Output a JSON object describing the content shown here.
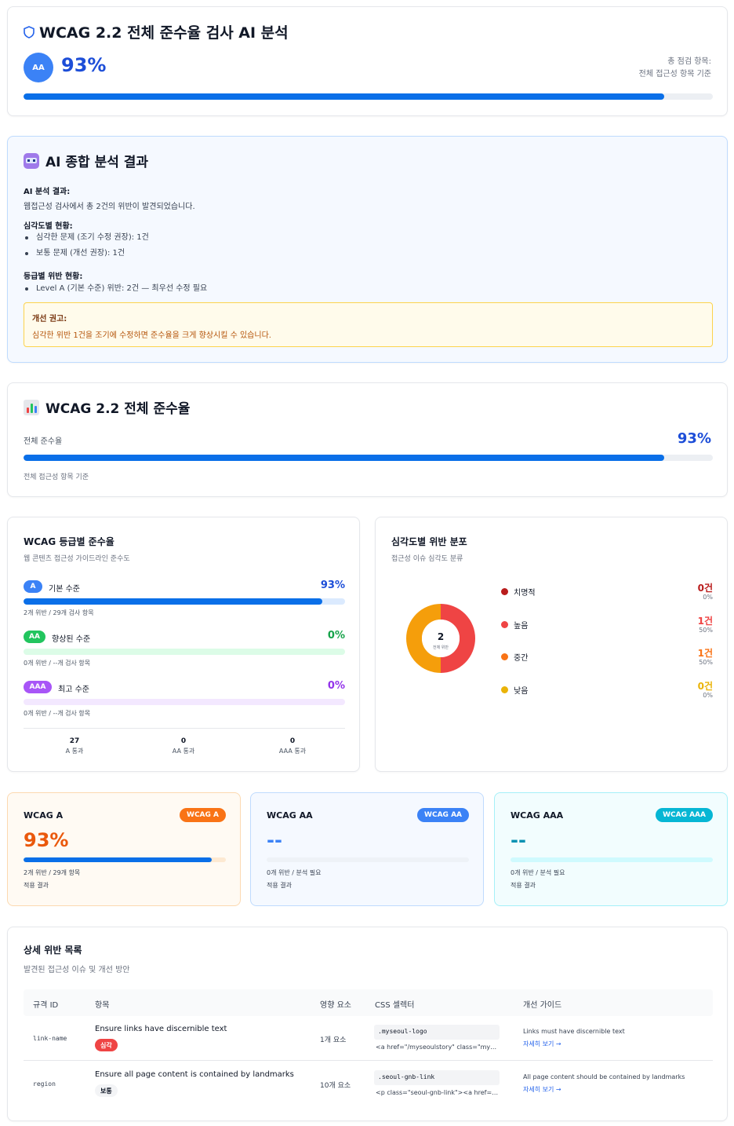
{
  "header": {
    "title": "WCAG 2.2 전체 준수율 검사 AI 분석",
    "level_badge": "AA",
    "score": "93%",
    "score_value": 0.93,
    "meta_line1": "총 점검 항목:",
    "meta_line2": "전체 접근성 항목 기준"
  },
  "ai_analysis": {
    "title": "AI 종합 분석 결과",
    "result_heading": "AI 분석 결과:",
    "result_text": "웹접근성 검사에서 총 2건의 위반이 발견되었습니다.",
    "severity_heading": "심각도별 현황:",
    "severity_items": [
      "심각한 문제 (조기 수정 권장): 1건",
      "보통 문제 (개선 권장): 1건"
    ],
    "level_heading": "등급별 위반 현황:",
    "level_items": [
      "Level A (기본 수준) 위반: 2건 — 최우선 수정 필요"
    ],
    "advice_heading": "개선 권고:",
    "advice_text": "심각한 위반 1건을 조기에 수정하면 준수율을 크게 향상시킬 수 있습니다."
  },
  "overall": {
    "title": "WCAG 2.2 전체 준수율",
    "label": "전체 준수율",
    "score": "93%",
    "score_value": 0.93,
    "note": "전체 접근성 항목 기준"
  },
  "level_compliance": {
    "title": "WCAG 등급별 준수율",
    "subtitle": "웹 콘텐츠 접근성 가이드라인 준수도",
    "levels": [
      {
        "badge": "A",
        "name": "기본 수준",
        "value": "93%",
        "fill": 0.93,
        "stat": "2개 위반 / 29개 검사 항목",
        "color": "#3b82f6",
        "track": "#dbeafe",
        "fill_color": "#0a6fe8",
        "value_color": "#1d4ed8"
      },
      {
        "badge": "AA",
        "name": "향상된 수준",
        "value": "0%",
        "fill": 0,
        "stat": "0개 위반 / --개 검사 항목",
        "color": "#22c55e",
        "track": "#dcfce7",
        "fill_color": "#16a34a",
        "value_color": "#16a34a"
      },
      {
        "badge": "AAA",
        "name": "최고 수준",
        "value": "0%",
        "fill": 0,
        "stat": "0개 위반 / --개 검사 항목",
        "color": "#a855f7",
        "track": "#f3e8ff",
        "fill_color": "#9333ea",
        "value_color": "#9333ea"
      }
    ],
    "summary": [
      {
        "n": "27",
        "label": "A 통과"
      },
      {
        "n": "0",
        "label": "AA 통과"
      },
      {
        "n": "0",
        "label": "AAA 통과"
      }
    ]
  },
  "severity": {
    "title": "심각도별 위반 분포",
    "subtitle": "접근성 이슈 심각도 분류",
    "total": "2",
    "total_label": "전체 위반",
    "items": [
      {
        "name": "치명적",
        "count": "0건",
        "pct": "0%",
        "value": 0,
        "color": "#b91c1c"
      },
      {
        "name": "높음",
        "count": "1건",
        "pct": "50%",
        "value": 1,
        "color": "#ef4444"
      },
      {
        "name": "중간",
        "count": "1건",
        "pct": "50%",
        "value": 1,
        "color": "#f97316"
      },
      {
        "name": "낮음",
        "count": "0건",
        "pct": "0%",
        "value": 0,
        "color": "#eab308"
      }
    ],
    "chart_colors": [
      "#ef4444",
      "#f59e0b"
    ]
  },
  "level_cards": [
    {
      "title": "WCAG A",
      "pill": "WCAG A",
      "big": "93%",
      "fill": 0.93,
      "s1": "2개 위반 / 29개 항목",
      "s2": "적용 결과",
      "accent": "#f97316",
      "big_color": "#ea580c",
      "bg": "#fffaf3",
      "border": "#fcd9b0",
      "track": "#fde9d2"
    },
    {
      "title": "WCAG AA",
      "pill": "WCAG AA",
      "big": "--",
      "fill": 0,
      "s1": "0개 위반 / 분석 필요",
      "s2": "적용 결과",
      "accent": "#3b82f6",
      "big_color": "#3b82f6",
      "bg": "#f5f9ff",
      "border": "#bfdbfe",
      "track": "#eef2f7"
    },
    {
      "title": "WCAG AAA",
      "pill": "WCAG AAA",
      "big": "--",
      "fill": 0,
      "s1": "0개 위반 / 분석 필요",
      "s2": "적용 결과",
      "accent": "#06b6d4",
      "big_color": "#0891b2",
      "bg": "#f2fdfe",
      "border": "#a5f0f8",
      "track": "#cffafe"
    }
  ],
  "details": {
    "title": "상세 위반 목록",
    "subtitle": "발견된 접근성 이슈 및 개선 방안",
    "columns": [
      "규격 ID",
      "항목",
      "영향 요소",
      "CSS 셀렉터",
      "개선 가이드"
    ],
    "rows": [
      {
        "id": "link-name",
        "item": "Ensure links have discernible text",
        "badge": "심각",
        "badge_bg": "#ef4444",
        "badge_fg": "#ffffff",
        "impact": "1개 요소",
        "selector": ".myseoul-logo",
        "html": "<a href=\"/myseoulstory\" class=\"myseoul-logo\">",
        "guide": "Links must have discernible text",
        "link": "자세히 보기 →"
      },
      {
        "id": "region",
        "item": "Ensure all page content is contained by landmarks",
        "badge": "보통",
        "badge_bg": "#f3f4f6",
        "badge_fg": "#111827",
        "impact": "10개 요소",
        "selector": ".seoul-gnb-link",
        "html": "<p class=\"seoul-gnb-link\"><a href=\"#\">",
        "guide": "All page content should be contained by landmarks",
        "link": "자세히 보기 →"
      }
    ]
  }
}
